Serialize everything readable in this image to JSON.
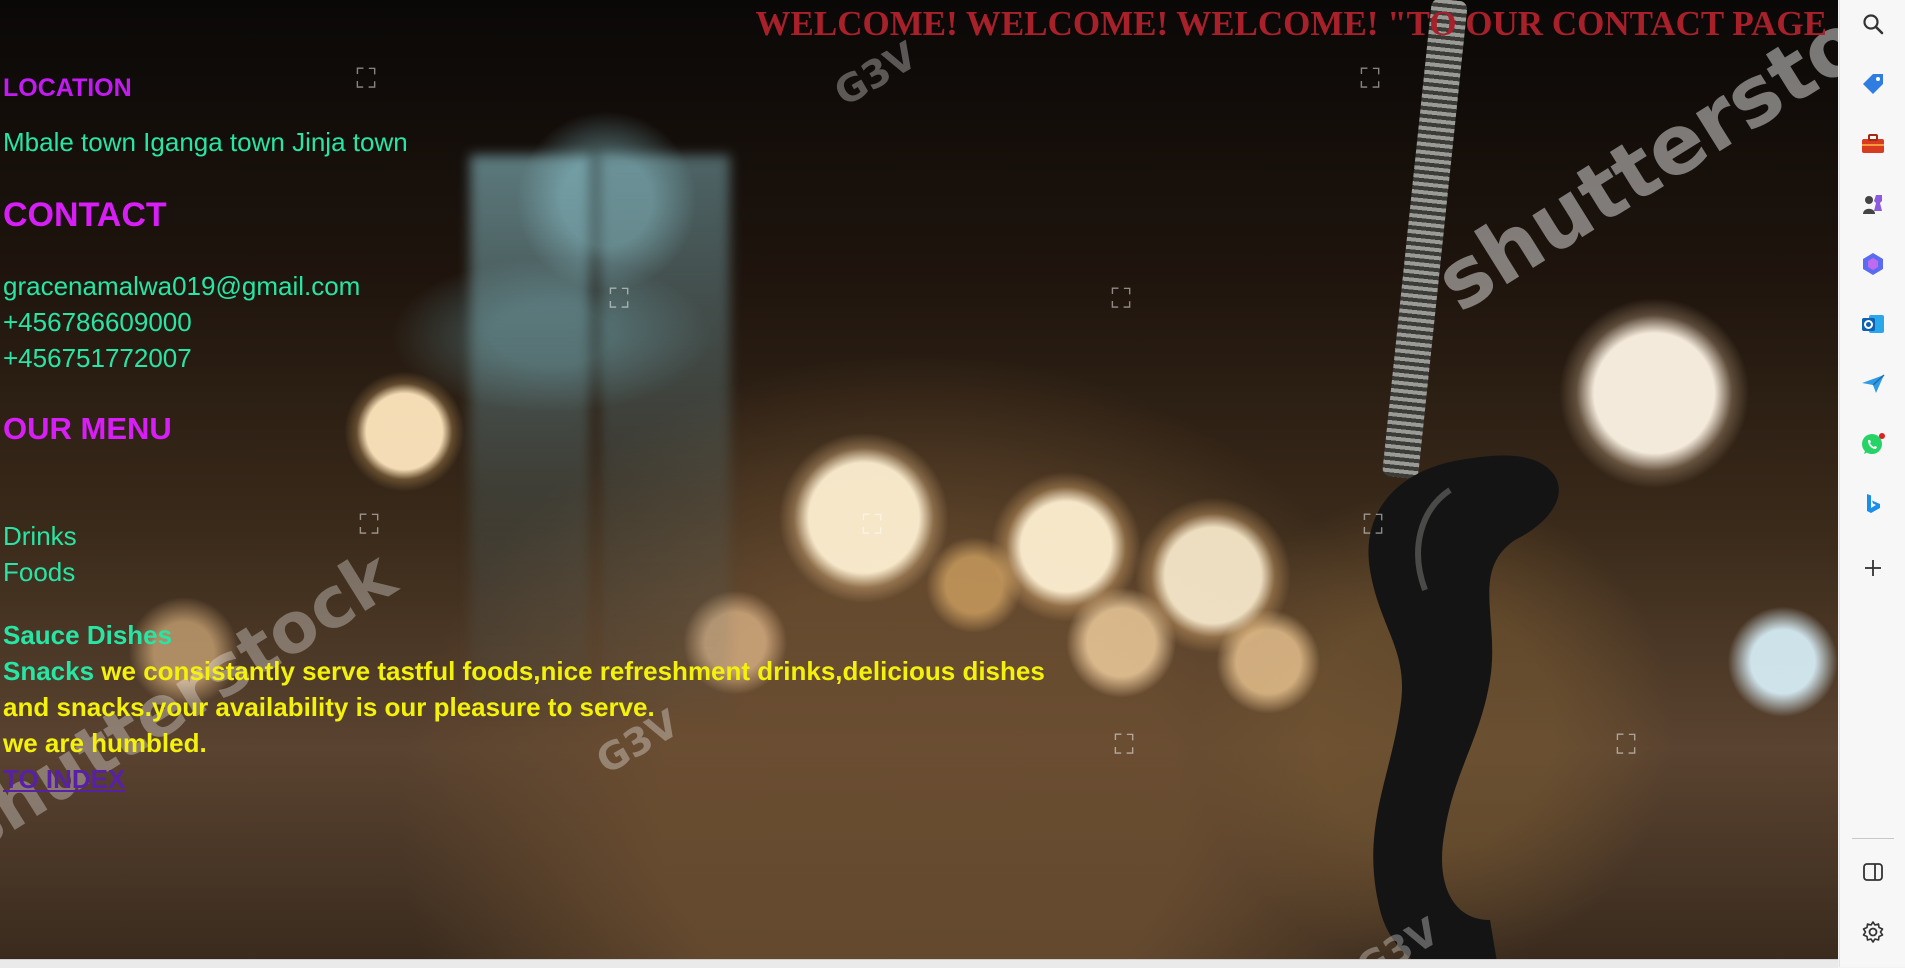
{
  "header": {
    "welcome_text": "WELCOME! WELCOME! WELCOME! \"TO OUR CONTACT PAGE"
  },
  "location": {
    "heading": "LOCATION",
    "towns": "Mbale town Iganga town Jinja town"
  },
  "contact": {
    "heading": "CONTACT",
    "email": "gracenamalwa019@gmail.com",
    "phone_1": "+456786609000",
    "phone_2": "+456751772007"
  },
  "menu": {
    "heading": "OUR MENU",
    "item_1": "Drinks",
    "item_2": "Foods",
    "item_3": "Sauce Dishes",
    "item_4": "Snacks",
    "description_line_1": " we consistantly serve tastful foods,nice refreshment drinks,delicious dishes",
    "description_line_2": "and snacks.your availability is our pleasure to serve.",
    "description_line_3": "we are humbled."
  },
  "nav": {
    "index_link": "TO INDEX"
  },
  "background": {
    "watermark_text": "shutterstock",
    "watermark_small": "G3V"
  },
  "sidebar": {
    "icons": [
      "search-icon",
      "shopping-tag-icon",
      "toolbox-icon",
      "games-icon",
      "copilot-icon",
      "outlook-icon",
      "send-icon",
      "whatsapp-icon",
      "bing-icon",
      "add-icon",
      "sidebar-toggle-icon",
      "settings-icon"
    ]
  },
  "colors": {
    "welcome": "#a8202a",
    "heading": "#d81ef6",
    "green_text": "#27e6a5",
    "yellow_text": "#f4f10a",
    "link": "#5a1fa8"
  }
}
